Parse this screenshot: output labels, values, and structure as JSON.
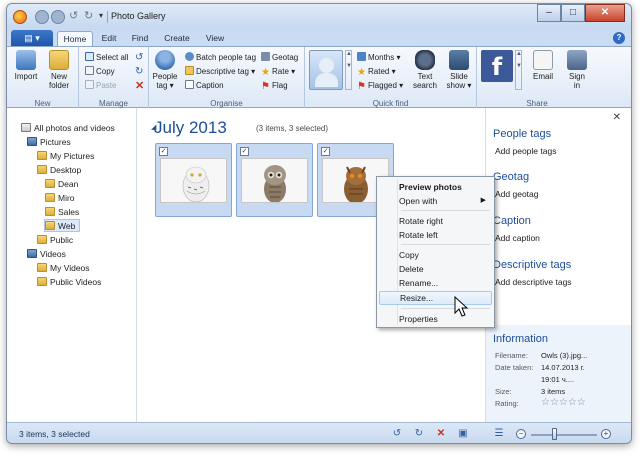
{
  "window": {
    "title": "Photo Gallery",
    "controls": {
      "minimize": "–",
      "maximize": "□",
      "close": "✕"
    }
  },
  "tabs": {
    "file": "▤ ▾",
    "items": [
      "Home",
      "Edit",
      "Find",
      "Create",
      "View"
    ],
    "help": "?"
  },
  "ribbon": {
    "new": {
      "label": "New",
      "import": "Import",
      "new_folder_line1": "New",
      "new_folder_line2": "folder"
    },
    "manage": {
      "label": "Manage",
      "select_all": "Select all",
      "copy": "Copy",
      "paste": "Paste"
    },
    "organise": {
      "label": "Organise",
      "people_tag_line1": "People",
      "people_tag_line2": "tag ▾",
      "batch_people_tag": "Batch people tag",
      "descriptive_tag": "Descriptive tag ▾",
      "caption": "Caption",
      "geotag": "Geotag",
      "rate": "Rate ▾",
      "flag": "Flag"
    },
    "quick_find": {
      "label": "Quick find",
      "months": "Months ▾",
      "rated": "Rated ▾",
      "flagged": "Flagged ▾",
      "text_search_line1": "Text",
      "text_search_line2": "search",
      "slide_show_line1": "Slide",
      "slide_show_line2": "show ▾"
    },
    "share": {
      "label": "Share",
      "facebook_logo": "f",
      "email": "Email",
      "sign_in_line1": "Sign",
      "sign_in_line2": "in"
    }
  },
  "nav": {
    "items": [
      "All photos and videos",
      "Pictures",
      "My Pictures",
      "Desktop",
      "Dean",
      "Miro",
      "Sales",
      "Web",
      "Public",
      "Videos",
      "My Videos",
      "Public Videos"
    ]
  },
  "gallery": {
    "group_title": "July 2013",
    "group_count": "(3 items, 3 selected)",
    "check": "✓"
  },
  "context_menu": {
    "items": [
      "Preview photos",
      "Open with",
      "Rotate right",
      "Rotate left",
      "Copy",
      "Delete",
      "Rename...",
      "Resize...",
      "Properties"
    ],
    "submenu_arrow": "▶"
  },
  "info_pane": {
    "close": "✕",
    "people_tags": {
      "heading": "People tags",
      "link": "Add people tags"
    },
    "geotag": {
      "heading": "Geotag",
      "link": "Add geotag"
    },
    "caption": {
      "heading": "Caption",
      "link": "Add caption"
    },
    "descriptive_tags": {
      "heading": "Descriptive tags",
      "link": "Add descriptive tags"
    },
    "information": {
      "heading": "Information",
      "rows": [
        {
          "label": "Filename:",
          "value": "Owls (3).jpg..."
        },
        {
          "label": "Date taken:",
          "value": "14.07.2013 г."
        },
        {
          "label": "",
          "value": "19:01 ч...."
        },
        {
          "label": "Size:",
          "value": "3 items"
        },
        {
          "label": "Rating:",
          "value": "☆☆☆☆☆"
        }
      ]
    }
  },
  "status_bar": {
    "text": "3 items, 3 selected",
    "zoom_out": "−",
    "zoom_in": "+",
    "zoom_level": 0.35
  },
  "colors": {
    "accent": "#1e4e9a",
    "selection": "#c8d9f2",
    "facebook": "#3b5998",
    "delete_red": "#c8321e"
  }
}
